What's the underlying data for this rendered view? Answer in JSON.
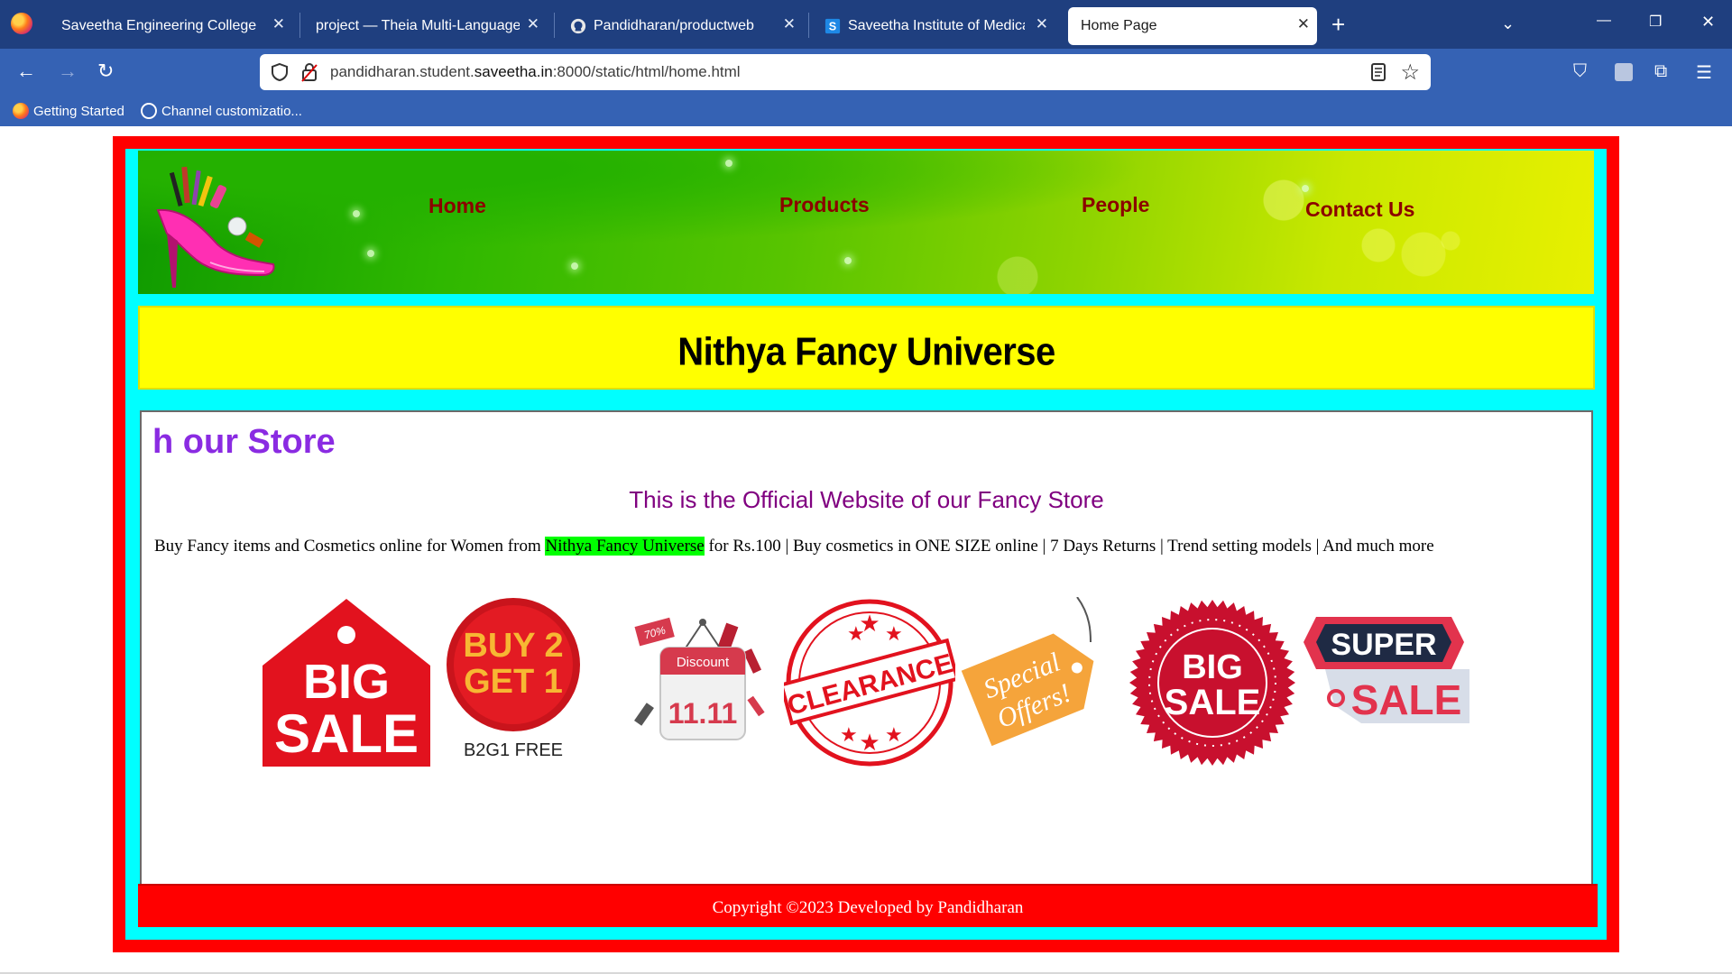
{
  "browser": {
    "tabs": [
      {
        "label": "Saveetha Engineering College",
        "active": false
      },
      {
        "label": "project — Theia Multi-Language Ex",
        "active": false
      },
      {
        "label": "Pandidharan/productweb",
        "active": false
      },
      {
        "label": "Saveetha Institute of Medical Ar",
        "active": false
      },
      {
        "label": "Home Page",
        "active": true
      }
    ],
    "url": {
      "prefix": "pandidharan.student.",
      "domain": "saveetha.in",
      "path": ":8000/static/html/home.html"
    },
    "bookmarks": [
      {
        "label": "Getting Started"
      },
      {
        "label": "Channel customizatio..."
      }
    ]
  },
  "page": {
    "nav": [
      "Home",
      "Products",
      "People",
      "Contact Us"
    ],
    "title": "Nithya Fancy Universe",
    "marquee": "h our Store",
    "subtitle": "This is the Official Website of our Fancy Store",
    "description": {
      "before": "Buy Fancy items and Cosmetics online for Women from ",
      "highlight": "Nithya Fancy Universe",
      "after": " for Rs.100 | Buy cosmetics in ONE SIZE online | 7 Days Returns | Trend setting models | And much more"
    },
    "badges": {
      "big_sale_1": [
        "BIG",
        "SALE"
      ],
      "b2g1": [
        "BUY 2",
        "GET 1",
        "B2G1 FREE"
      ],
      "discount": [
        "Discount",
        "11.11",
        "70%"
      ],
      "clearance": "CLEARANCE",
      "special": [
        "Special",
        "Offers!"
      ],
      "big_sale_2": [
        "BIG",
        "SALE"
      ],
      "super_sale": [
        "SUPER",
        "SALE"
      ]
    },
    "footer": "Copyright ©2023 Developed by Pandidharan"
  },
  "colors": {
    "outer_border": "#ff0000",
    "inner_frame": "#00ffff",
    "title_band": "#ffff00",
    "nav_text": "#8b0000",
    "marquee_text": "#8a2be2",
    "subtitle_text": "#800080",
    "highlight": "#00ff00",
    "footer_bg": "#ff0000"
  },
  "icons": [
    "firefox-icon",
    "github-icon",
    "saveetha-s-icon",
    "shield-icon",
    "lock-icon",
    "reader-icon",
    "star-icon",
    "pocket-icon",
    "extensions-icon",
    "menu-icon",
    "globe-icon"
  ]
}
